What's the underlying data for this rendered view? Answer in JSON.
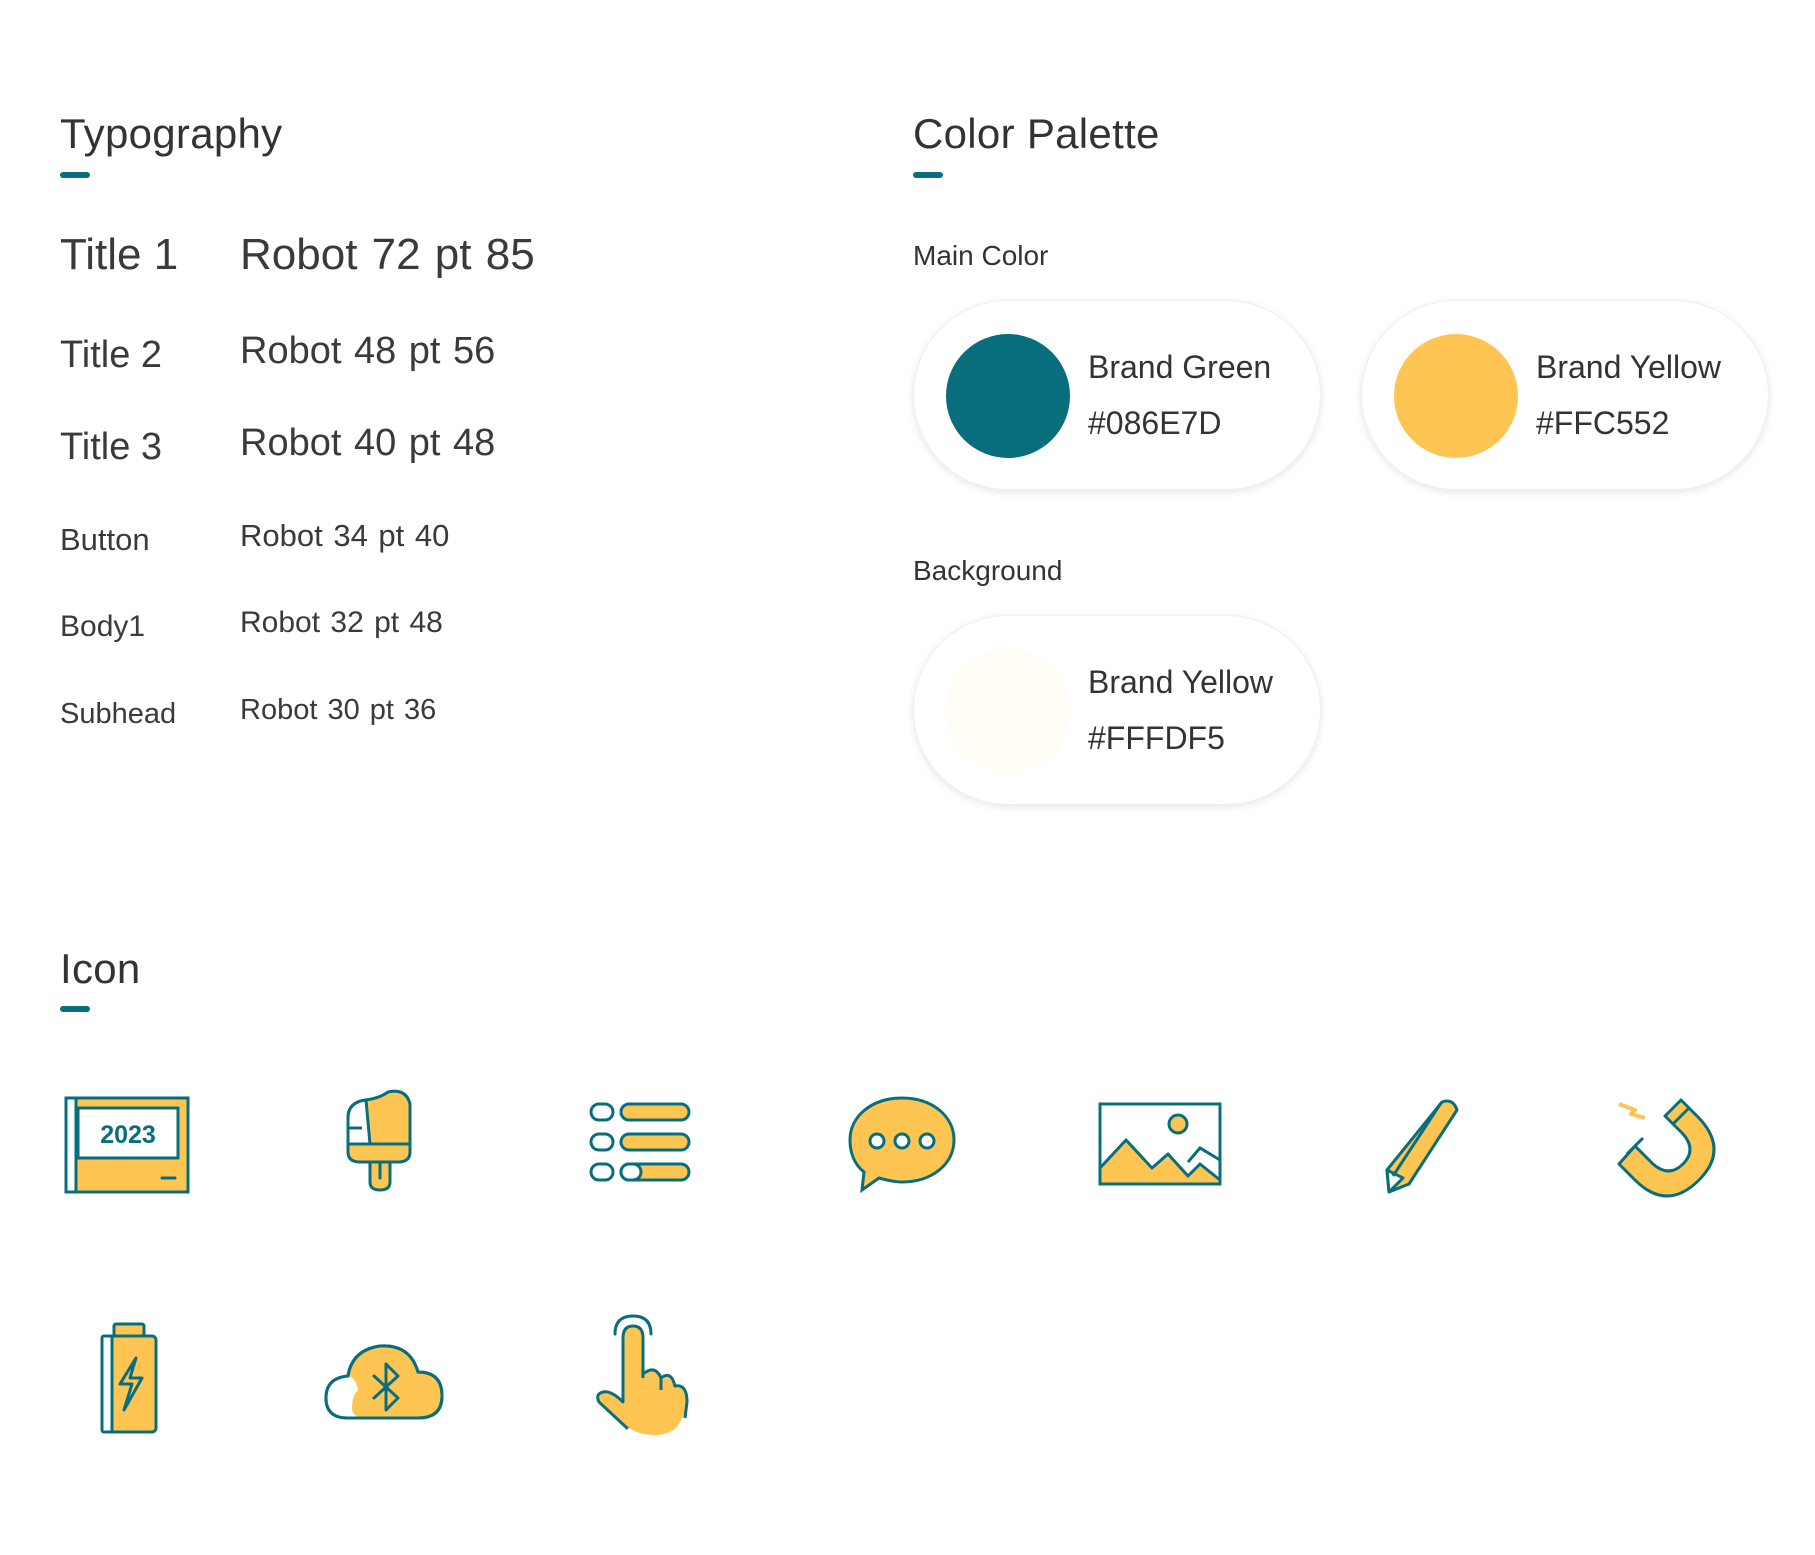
{
  "typography": {
    "title": "Typography",
    "rows": [
      {
        "name": "Title 1",
        "spec": "Robot 72 pt  85"
      },
      {
        "name": "Title 2",
        "spec": "Robot 48 pt  56"
      },
      {
        "name": "Title 3",
        "spec": "Robot 40 pt  48"
      },
      {
        "name": "Button",
        "spec": "Robot 34 pt  40"
      },
      {
        "name": "Body1",
        "spec": "Robot 32 pt  48"
      },
      {
        "name": "Subhead",
        "spec": "Robot 30 pt  36"
      }
    ]
  },
  "palette": {
    "title": "Color Palette",
    "main_label": "Main Color",
    "background_label": "Background",
    "main": [
      {
        "name": "Brand Green",
        "hex": "#086E7D",
        "color": "#086E7D"
      },
      {
        "name": "Brand Yellow",
        "hex": "#FFC552",
        "color": "#FFC552"
      }
    ],
    "background": [
      {
        "name": "Brand Yellow",
        "hex": "#FFFDF5",
        "color": "#FFFDF5"
      }
    ]
  },
  "icons": {
    "title": "Icon",
    "calendar_year": "2023",
    "items": [
      "calendar-icon",
      "paint-brush-icon",
      "list-icon",
      "chat-bubble-icon",
      "image-icon",
      "pencil-icon",
      "magnet-icon",
      "battery-charging-icon",
      "cloud-bluetooth-icon",
      "tap-hand-icon"
    ]
  },
  "colors": {
    "accent": "#086E7D",
    "fill": "#FFC552"
  }
}
